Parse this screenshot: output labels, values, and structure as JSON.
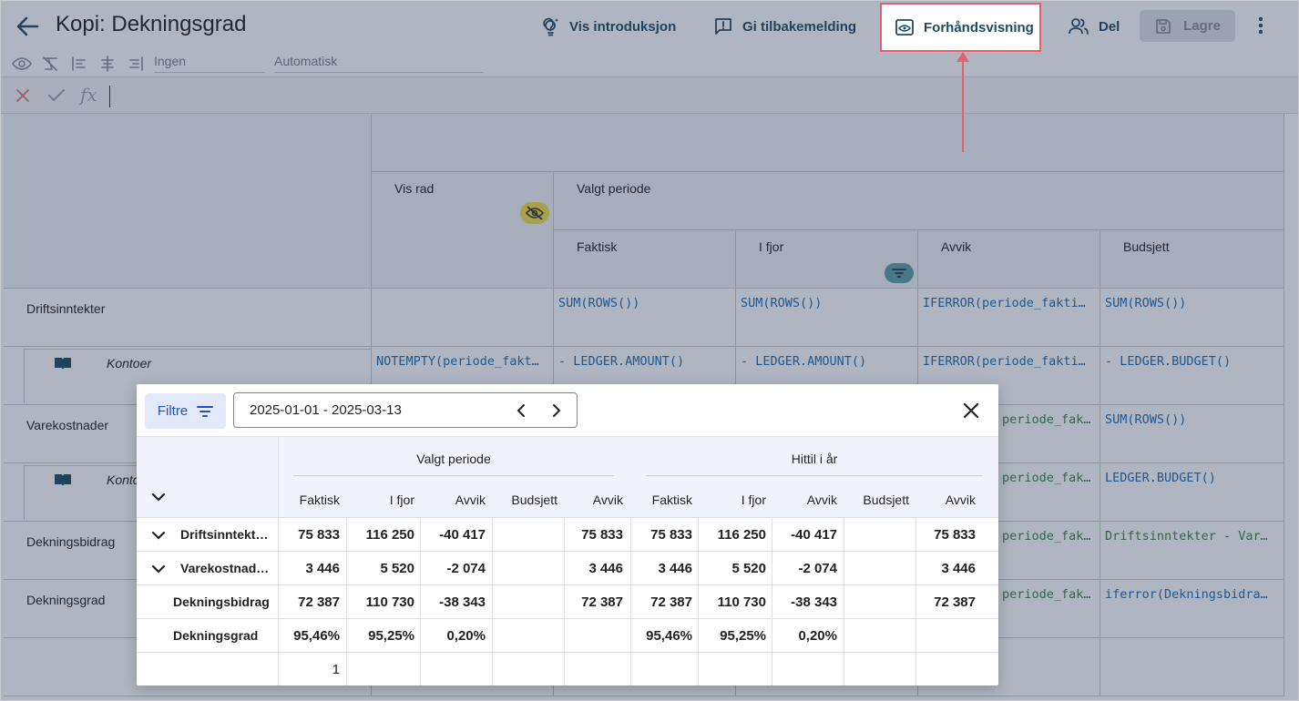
{
  "header": {
    "title": "Kopi: Dekningsgrad",
    "buttons": {
      "intro": "Vis introduksjon",
      "feedback": "Gi tilbakemelding",
      "preview": "Forhåndsvisning",
      "share": "Del",
      "save": "Lagre"
    }
  },
  "format_bar": {
    "style_value": "Ingen",
    "mode_value": "Automatisk"
  },
  "formula_bar": {
    "fx_label": "fx"
  },
  "grid": {
    "header": {
      "vis_rad": "Vis rad",
      "valgt_periode": "Valgt periode",
      "columns": [
        "Faktisk",
        "I fjor",
        "Avvik",
        "Budsjett"
      ]
    },
    "rows": [
      {
        "label": "Driftsinntekter",
        "vis": "",
        "faktisk": "SUM(ROWS())",
        "ifjor": "SUM(ROWS())",
        "avvik": "IFERROR(periode_fakti…",
        "budsjett": "SUM(ROWS())"
      },
      {
        "label": "Kontoer",
        "vis": "NOTEMPTY(periode_fakt…",
        "faktisk": "- LEDGER.AMOUNT()",
        "ifjor": "- LEDGER.AMOUNT()",
        "avvik": "IFERROR(periode_fakti…",
        "budsjett": "- LEDGER.BUDGET()"
      },
      {
        "label": "Varekostnader",
        "avvik": "periode_fakti…",
        "budsjett": "SUM(ROWS())"
      },
      {
        "label": "Kontoer",
        "avvik": "periode_fakti…",
        "budsjett": "LEDGER.BUDGET()"
      },
      {
        "label": "Dekningsbidrag",
        "avvik": "periode_fakti…",
        "budsjett": "Driftsinntekter - Var…"
      },
      {
        "label": "Dekningsgrad",
        "avvik": "periode_fakti…",
        "budsjett": "iferror(Dekningsbidra…"
      }
    ]
  },
  "preview_modal": {
    "filter_label": "Filtre",
    "date_range": "2025-01-01 - 2025-03-13",
    "groups": [
      "Valgt periode",
      "Hittil i år"
    ],
    "columns": [
      "Faktisk",
      "I fjor",
      "Avvik",
      "Budsjett",
      "Avvik",
      "Faktisk",
      "I fjor",
      "Avvik",
      "Budsjett",
      "Avvik"
    ],
    "rows": [
      {
        "label": "Driftsinntekt…",
        "values": [
          "75 833",
          "116 250",
          "-40 417",
          "",
          "75 833",
          "75 833",
          "116 250",
          "-40 417",
          "",
          "75 833"
        ]
      },
      {
        "label": "Varekostnad…",
        "values": [
          "3 446",
          "5 520",
          "-2 074",
          "",
          "3 446",
          "3 446",
          "5 520",
          "-2 074",
          "",
          "3 446"
        ]
      },
      {
        "label": "Dekningsbidrag",
        "values": [
          "72 387",
          "110 730",
          "-38 343",
          "",
          "72 387",
          "72 387",
          "110 730",
          "-38 343",
          "",
          "72 387"
        ]
      },
      {
        "label": "Dekningsgrad",
        "values": [
          "95,46%",
          "95,25%",
          "0,20%",
          "",
          "",
          "95,46%",
          "95,25%",
          "0,20%",
          "",
          ""
        ]
      },
      {
        "label": "",
        "values": [
          "1",
          "",
          "",
          "",
          "",
          "",
          "",
          "",
          "",
          ""
        ]
      }
    ]
  }
}
